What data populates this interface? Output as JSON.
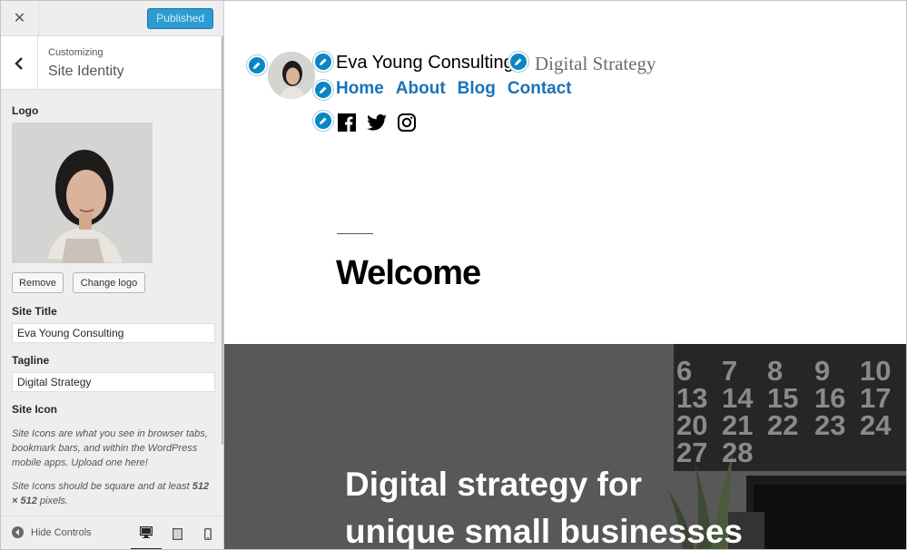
{
  "topbar": {
    "close": "✕",
    "publish_label": "Published"
  },
  "section": {
    "customizing": "Customizing",
    "title": "Site Identity"
  },
  "logo": {
    "label": "Logo",
    "remove_label": "Remove",
    "change_label": "Change logo"
  },
  "site_title": {
    "label": "Site Title",
    "value": "Eva Young Consulting"
  },
  "tagline": {
    "label": "Tagline",
    "value": "Digital Strategy"
  },
  "site_icon": {
    "label": "Site Icon",
    "desc1": "Site Icons are what you see in browser tabs, bookmark bars, and within the WordPress mobile apps. Upload one here!",
    "desc2_prefix": "Site Icons should be square and at least ",
    "desc2_bold": "512 × 512",
    "desc2_suffix": " pixels."
  },
  "footer": {
    "hide_controls": "Hide Controls",
    "devices": [
      "desktop-icon",
      "tablet-icon",
      "mobile-icon"
    ]
  },
  "preview": {
    "site_title": "Eva Young Consulting",
    "tagline": "Digital Strategy",
    "nav": [
      "Home",
      "About",
      "Blog",
      "Contact"
    ],
    "social": [
      "facebook-icon",
      "twitter-icon",
      "instagram-icon"
    ],
    "heading": "Welcome",
    "hero_line1": "Digital strategy for",
    "hero_line2": "unique small businesses",
    "calendar": [
      "6",
      "7",
      "8",
      "9",
      "10",
      "13",
      "14",
      "15",
      "16",
      "17",
      "20",
      "21",
      "22",
      "23",
      "24",
      "27",
      "28"
    ]
  },
  "colors": {
    "accent": "#0b86c4",
    "publish": "#2b9cd1",
    "nav": "#1a73b9"
  }
}
